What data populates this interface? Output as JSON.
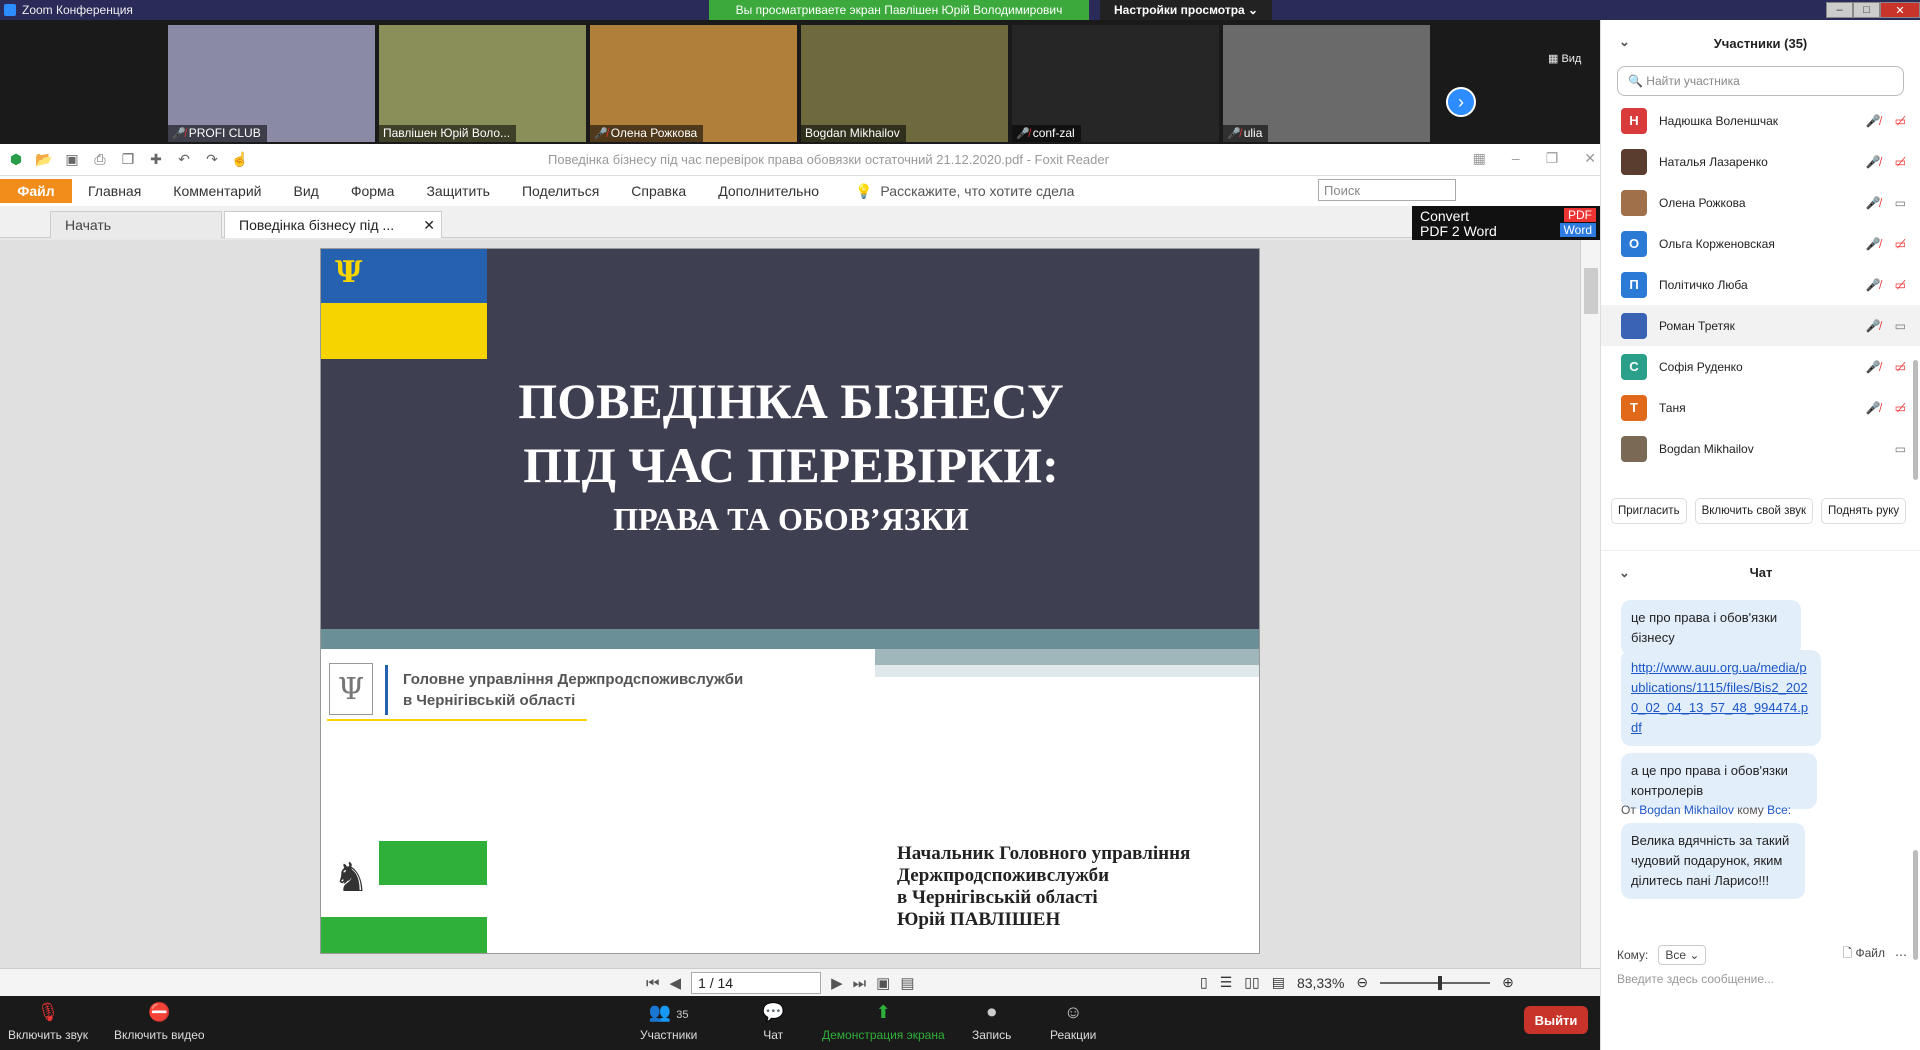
{
  "zoom": {
    "title": "Zoom Конференция",
    "banner": "Вы просматриваете экран Павлішен Юрій Володимирович",
    "view_settings": "Настройки просмотра ⌄",
    "view_label": "Вид",
    "tiles": [
      {
        "name": "PROFI CLUB",
        "muted": true,
        "bg": "#8a8aa6"
      },
      {
        "name": "Павлішен Юрій Воло...",
        "muted": false,
        "bg": "#8a8f5a"
      },
      {
        "name": "Олена Рожкова",
        "muted": true,
        "bg": "#b07f3a"
      },
      {
        "name": "Bogdan Mikhailov",
        "muted": false,
        "bg": "#6e6a3e"
      },
      {
        "name": "conf-zal",
        "muted": true,
        "bg": "#262626"
      },
      {
        "name": "ulia",
        "muted": true,
        "bg": "#6a6a6a"
      }
    ],
    "bottom": {
      "mute": "Включить звук",
      "video": "Включить видео",
      "participants": "Участники",
      "participants_count": "35",
      "chat": "Чат",
      "share": "Демонстрация экрана",
      "record": "Запись",
      "reactions": "Реакции",
      "leave": "Выйти"
    }
  },
  "foxit": {
    "title": "Поведінка бізнесу під час перевірок права обовязки остаточний 21.12.2020.pdf - Foxit Reader",
    "menu": {
      "file": "Файл",
      "items": [
        "Главная",
        "Комментарий",
        "Вид",
        "Форма",
        "Защитить",
        "Поделиться",
        "Справка",
        "Дополнительно"
      ],
      "tell": "Расскажите, что хотите сдела"
    },
    "search_placeholder": "Поиск",
    "tabs": {
      "start": "Начать",
      "doc": "Поведінка бізнесу під ..."
    },
    "convert": {
      "line1": "Convert",
      "line2": "PDF 2 Word",
      "pdf": "PDF",
      "word": "Word"
    },
    "page_indicator": "1 / 14",
    "zoom": "83,33%"
  },
  "slide": {
    "title_line1": "ПОВЕДІНКА БІЗНЕСУ",
    "title_line2": "ПІД ЧАС ПЕРЕВІРКИ:",
    "title_line3": "ПРАВА ТА ОБОВ’ЯЗКИ",
    "agency_line1": "Головне управління Держпродспоживслужби",
    "agency_line2": "в Чернігівській області",
    "signer_line1": "Начальник Головного управління",
    "signer_line2": "Держпродспоживслужби",
    "signer_line3": "в Чернігівській області",
    "signer_line4": "Юрій ПАВЛІШЕН"
  },
  "participants": {
    "header": "Участники (35)",
    "search_placeholder": "Найти участника",
    "list": [
      {
        "initial": "Н",
        "name": "Надюшка Воленшчак",
        "color": "#d93b3b",
        "video": false
      },
      {
        "initial": "",
        "name": "Наталья Лазаренко",
        "color": "#5a3d2e",
        "video": false
      },
      {
        "initial": "",
        "name": "Олена Рожкова",
        "color": "#a0704a",
        "video": true
      },
      {
        "initial": "О",
        "name": "Ольга Корженовская",
        "color": "#2b7bd6",
        "video": false
      },
      {
        "initial": "П",
        "name": "Політичко Люба",
        "color": "#2b7bd6",
        "video": false
      },
      {
        "initial": "",
        "name": "Роман Третяк",
        "color": "#3b63b5",
        "video": true
      },
      {
        "initial": "С",
        "name": "Софія Руденко",
        "color": "#2aa08a",
        "video": false
      },
      {
        "initial": "Т",
        "name": "Таня",
        "color": "#e06a1a",
        "video": false
      },
      {
        "initial": "",
        "name": "Bogdan Mikhailov",
        "color": "#7a6a55",
        "video": true
      }
    ],
    "buttons": {
      "invite": "Пригласить",
      "unmute": "Включить свой звук",
      "raise": "Поднять руку"
    }
  },
  "chat": {
    "header": "Чат",
    "msg1": "це про права і обов'язки бізнесу",
    "link": "http://www.auu.org.ua/media/publications/1115/files/Bis2_2020_02_04_13_57_48_994474.pdf",
    "msg2": "а це про права і обов'язки контролерів",
    "from_prefix": "От",
    "from_user": "Bogdan Mikhailov",
    "to_word": "кому",
    "to_user": "Все:",
    "msg3": "Велика вдячність за такий чудовий подарунок, яким ділитесь пані Ларисо!!!",
    "to_label": "Кому:",
    "to_value": "Все",
    "file_label": "Файл",
    "input_placeholder": "Введите здесь сообщение..."
  }
}
